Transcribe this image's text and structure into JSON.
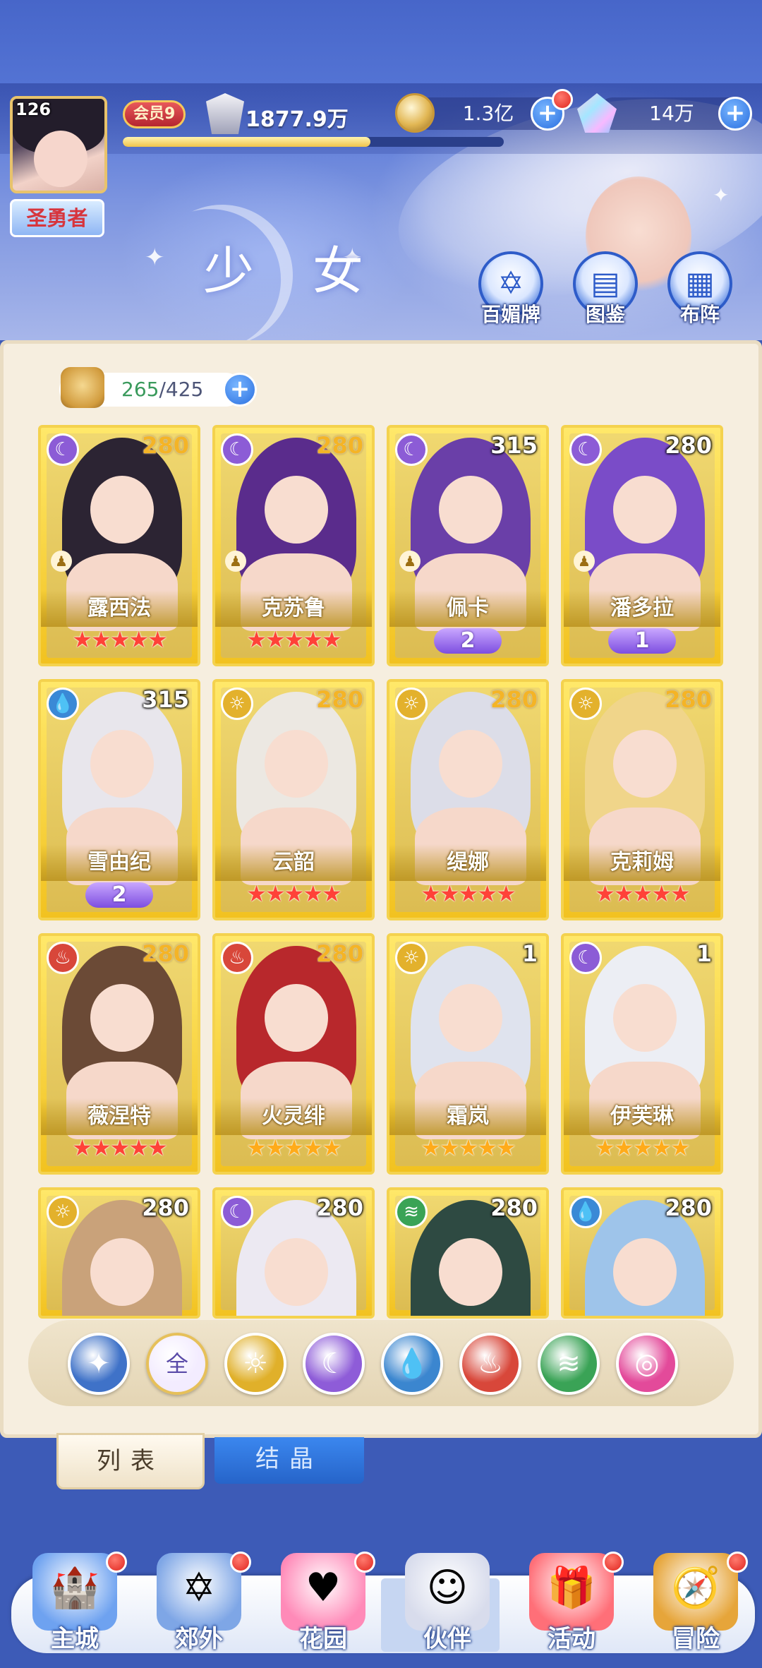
{
  "header": {
    "avatar_level": "126",
    "title_badge": "圣勇者",
    "vip": "会员9",
    "power": "1877.9万",
    "exp_progress": 0.65,
    "gold": "1.3亿",
    "gems": "14万",
    "page_title": "少 女",
    "functions": [
      {
        "label": "百媚牌",
        "icon": "hexagram-icon"
      },
      {
        "label": "图鉴",
        "icon": "book-icon"
      },
      {
        "label": "布阵",
        "icon": "grid-icon"
      }
    ]
  },
  "roster": {
    "count_current": "265",
    "count_rest": "/425"
  },
  "cards": [
    {
      "name": "露西法",
      "level": "280",
      "element": "moon",
      "stars": 5,
      "star_color": "red",
      "wing": "",
      "gold_level": true,
      "chess": true
    },
    {
      "name": "克苏鲁",
      "level": "280",
      "element": "moon",
      "stars": 5,
      "star_color": "red",
      "wing": "",
      "gold_level": true,
      "chess": true
    },
    {
      "name": "佩卡",
      "level": "315",
      "element": "moon",
      "stars": 0,
      "star_color": "red",
      "wing": "2",
      "gold_level": false,
      "chess": true
    },
    {
      "name": "潘多拉",
      "level": "280",
      "element": "moon",
      "stars": 0,
      "star_color": "red",
      "wing": "1",
      "gold_level": false,
      "chess": true
    },
    {
      "name": "雪由纪",
      "level": "315",
      "element": "water",
      "stars": 0,
      "star_color": "red",
      "wing": "2",
      "gold_level": false,
      "chess": false
    },
    {
      "name": "云韶",
      "level": "280",
      "element": "sun",
      "stars": 5,
      "star_color": "red",
      "wing": "",
      "gold_level": true,
      "chess": false
    },
    {
      "name": "缇娜",
      "level": "280",
      "element": "sun",
      "stars": 5,
      "star_color": "red",
      "wing": "",
      "gold_level": true,
      "chess": false
    },
    {
      "name": "克莉姆",
      "level": "280",
      "element": "sun",
      "stars": 5,
      "star_color": "red",
      "wing": "",
      "gold_level": true,
      "chess": false
    },
    {
      "name": "薇涅特",
      "level": "280",
      "element": "fire",
      "stars": 5,
      "star_color": "red",
      "wing": "",
      "gold_level": true,
      "chess": false
    },
    {
      "name": "火灵绯",
      "level": "280",
      "element": "fire",
      "stars": 5,
      "star_color": "gold",
      "wing": "",
      "gold_level": true,
      "chess": false
    },
    {
      "name": "霜岚",
      "level": "1",
      "element": "sun",
      "stars": 5,
      "star_color": "gold",
      "wing": "",
      "gold_level": false,
      "chess": false
    },
    {
      "name": "伊芙琳",
      "level": "1",
      "element": "moon",
      "stars": 5,
      "star_color": "gold",
      "wing": "",
      "gold_level": false,
      "chess": false
    },
    {
      "name": "",
      "level": "280",
      "element": "sun",
      "stars": 0,
      "star_color": "red",
      "wing": "",
      "gold_level": false,
      "chess": false
    },
    {
      "name": "",
      "level": "280",
      "element": "moon",
      "stars": 0,
      "star_color": "red",
      "wing": "",
      "gold_level": false,
      "chess": false
    },
    {
      "name": "",
      "level": "280",
      "element": "wind",
      "stars": 0,
      "star_color": "red",
      "wing": "",
      "gold_level": false,
      "chess": false
    },
    {
      "name": "",
      "level": "280",
      "element": "water",
      "stars": 0,
      "star_color": "red",
      "wing": "",
      "gold_level": false,
      "chess": false
    }
  ],
  "filters": [
    {
      "id": "special",
      "label": "",
      "icon": "star-burst-icon",
      "color": "#3f72c8"
    },
    {
      "id": "all",
      "label": "全",
      "icon": "all-icon",
      "color": "#f3ecff"
    },
    {
      "id": "sun",
      "label": "",
      "icon": "sun-icon",
      "color": "#e0b02a"
    },
    {
      "id": "moon",
      "label": "",
      "icon": "moon-icon",
      "color": "#8e5cd8"
    },
    {
      "id": "water",
      "label": "",
      "icon": "water-drop-icon",
      "color": "#3b86cf"
    },
    {
      "id": "fire",
      "label": "",
      "icon": "fire-icon",
      "color": "#d8473a"
    },
    {
      "id": "wind",
      "label": "",
      "icon": "wind-icon",
      "color": "#3aa356"
    },
    {
      "id": "planet",
      "label": "",
      "icon": "planet-icon",
      "color": "#e34a9a"
    }
  ],
  "tabs": {
    "list": "列表",
    "crystal": "结晶"
  },
  "nav": [
    {
      "label": "主城",
      "icon": "castle-icon",
      "dot": true
    },
    {
      "label": "郊外",
      "icon": "portal-icon",
      "dot": true
    },
    {
      "label": "花园",
      "icon": "heart-icon",
      "dot": true
    },
    {
      "label": "伙伴",
      "icon": "partner-icon",
      "dot": false
    },
    {
      "label": "活动",
      "icon": "gift-icon",
      "dot": true
    },
    {
      "label": "冒险",
      "icon": "compass-icon",
      "dot": true
    }
  ],
  "colors": {
    "element_moon": "#8c5cd6",
    "element_sun": "#e3b12c",
    "element_water": "#3a89d6",
    "element_fire": "#d8473a",
    "element_wind": "#3aa356"
  }
}
